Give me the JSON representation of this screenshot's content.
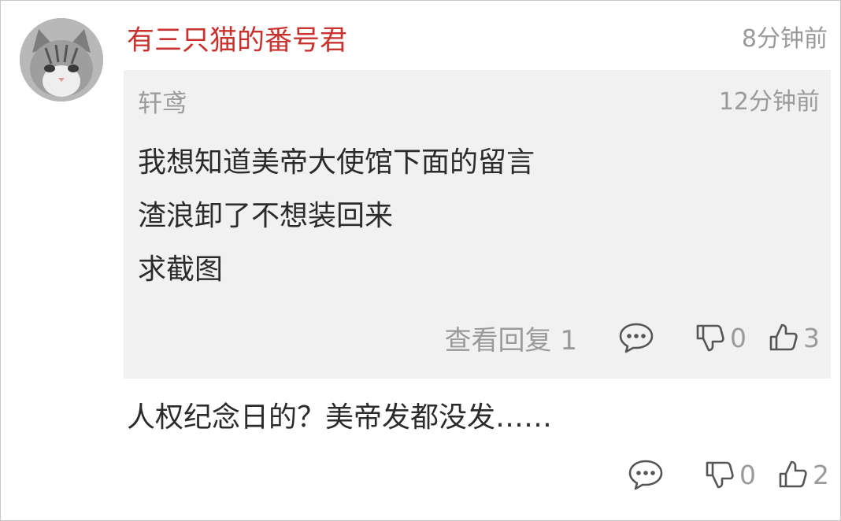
{
  "comment": {
    "username": "有三只猫的番号君",
    "time": "8分钟前",
    "text": "人权纪念日的？美帝发都没发……",
    "dislike_count": "0",
    "like_count": "2",
    "username_color": "#c8322f"
  },
  "quoted_comment": {
    "username": "轩鸢",
    "time": "12分钟前",
    "lines": [
      "我想知道美帝大使馆下面的留言",
      "渣浪卸了不想装回来",
      "求截图"
    ],
    "view_replies": "查看回复 1",
    "dislike_count": "0",
    "like_count": "3"
  },
  "icons": {
    "avatar": "cat-avatar",
    "reply": "speech-bubble-icon",
    "dislike": "thumbs-down-icon",
    "like": "thumbs-up-icon"
  }
}
